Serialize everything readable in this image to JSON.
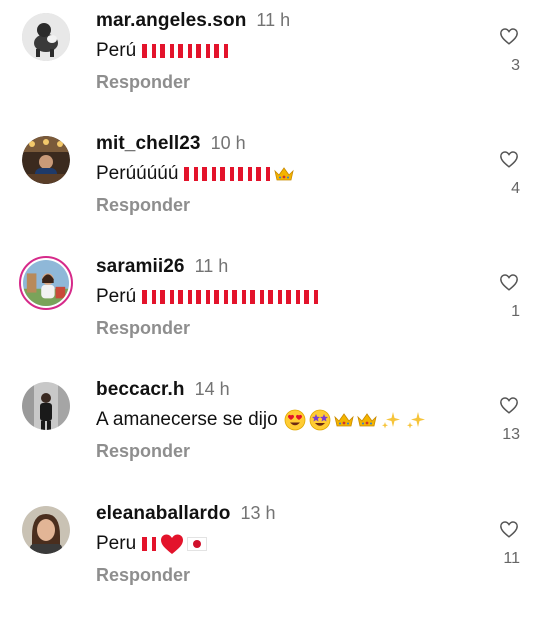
{
  "comments": [
    {
      "username": "mar.angeles.son",
      "time": "11 h",
      "text": "Perú",
      "emojis": [
        "flag-peru",
        "flag-peru",
        "flag-peru",
        "flag-peru",
        "flag-peru"
      ],
      "reply_label": "Responder",
      "likes": "3",
      "avatar": "dog-avatar"
    },
    {
      "username": "mit_chell23",
      "time": "10 h",
      "text": "Perúúúúú",
      "emojis": [
        "flag-peru",
        "flag-peru",
        "flag-peru",
        "flag-peru",
        "flag-peru",
        "crown"
      ],
      "reply_label": "Responder",
      "likes": "4",
      "avatar": "restaurant-avatar"
    },
    {
      "username": "saramii26",
      "time": "11 h",
      "text": "Perú",
      "emojis": [
        "flag-peru",
        "flag-peru",
        "flag-peru",
        "flag-peru",
        "flag-peru",
        "flag-peru",
        "flag-peru",
        "flag-peru",
        "flag-peru",
        "flag-peru"
      ],
      "reply_label": "Responder",
      "likes": "1",
      "avatar": "woman-outdoor-avatar",
      "story_ring": true
    },
    {
      "username": "beccacr.h",
      "time": "14 h",
      "text": "A amanecerse se dijo",
      "emojis": [
        "heart-eyes",
        "star-struck",
        "crown",
        "crown",
        "sparkles",
        "sparkles"
      ],
      "reply_label": "Responder",
      "likes": "13",
      "avatar": "street-avatar"
    },
    {
      "username": "eleanaballardo",
      "time": "13 h",
      "text": "Peru",
      "emojis": [
        "flag-peru",
        "red-heart",
        "flag-japan"
      ],
      "reply_label": "Responder",
      "likes": "11",
      "avatar": "woman-portrait-avatar"
    }
  ],
  "colors": {
    "text": "#111111",
    "secondary": "#737373",
    "reply": "#8e8e8e",
    "flag_red": "#e3132b",
    "story_ring": "#d62a8a"
  }
}
